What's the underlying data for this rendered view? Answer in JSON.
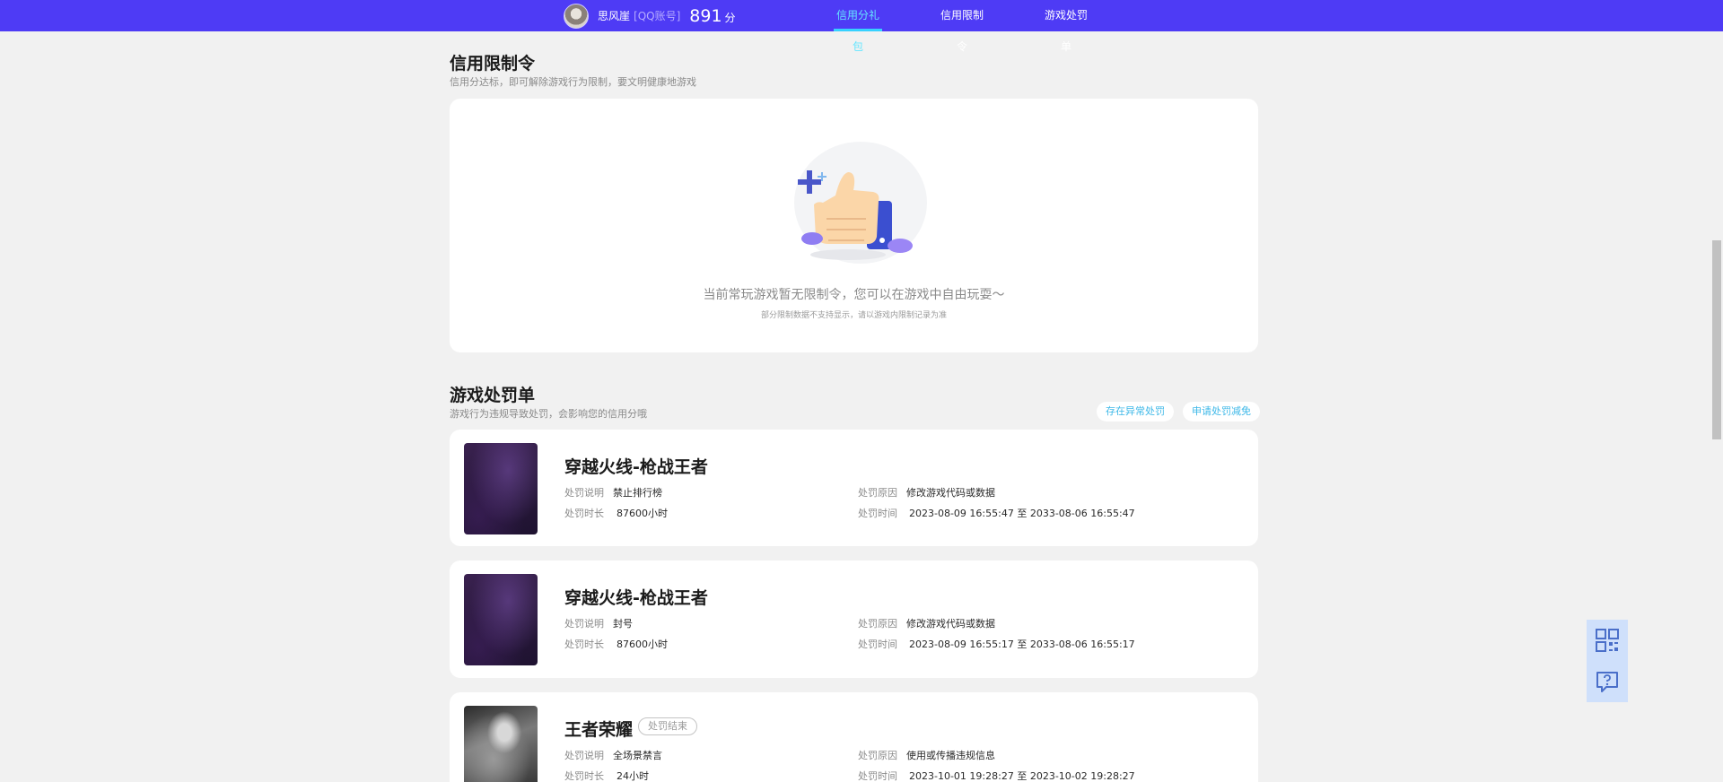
{
  "header": {
    "username": "思风崖",
    "account_type": "[QQ账号]",
    "score": "891",
    "score_unit": "分",
    "nav": [
      {
        "label": "信用分礼包",
        "active": true
      },
      {
        "label": "信用限制令",
        "active": false
      },
      {
        "label": "游戏处罚单",
        "active": false
      }
    ]
  },
  "restriction": {
    "title": "信用限制令",
    "subtitle": "信用分达标，即可解除游戏行为限制，要文明健康地游戏",
    "empty_message": "当前常玩游戏暂无限制令，您可以在游戏中自由玩耍～",
    "empty_note": "部分限制数据不支持显示，请以游戏内限制记录为准"
  },
  "penalty": {
    "title": "游戏处罚单",
    "subtitle": "游戏行为违规导致处罚，会影响您的信用分哦",
    "actions": [
      "存在异常处罚",
      "申请处罚减免"
    ],
    "labels": {
      "desc": "处罚说明",
      "duration": "处罚时长",
      "reason": "处罚原因",
      "time": "处罚时间"
    },
    "items": [
      {
        "game": "穿越火线-枪战王者",
        "status": "",
        "desc": "禁止排行榜",
        "duration": "87600小时",
        "reason": "修改游戏代码或数据",
        "time": "2023-08-09 16:55:47 至 2033-08-06 16:55:47"
      },
      {
        "game": "穿越火线-枪战王者",
        "status": "",
        "desc": "封号",
        "duration": "87600小时",
        "reason": "修改游戏代码或数据",
        "time": "2023-08-09 16:55:17 至 2033-08-06 16:55:17"
      },
      {
        "game": "王者荣耀",
        "status": "处罚结束",
        "desc": "全场景禁言",
        "duration": "24小时",
        "reason": "使用或传播违规信息",
        "time": "2023-10-01 19:28:27 至 2023-10-02 19:28:27"
      }
    ]
  },
  "side_tools": [
    {
      "icon": "qr-code-icon"
    },
    {
      "icon": "feedback-icon"
    }
  ],
  "colors": {
    "header_bg": "#4e3bf5",
    "nav_active": "#66e6ff",
    "link": "#3db8e8",
    "page_bg": "#f1f1f1"
  }
}
